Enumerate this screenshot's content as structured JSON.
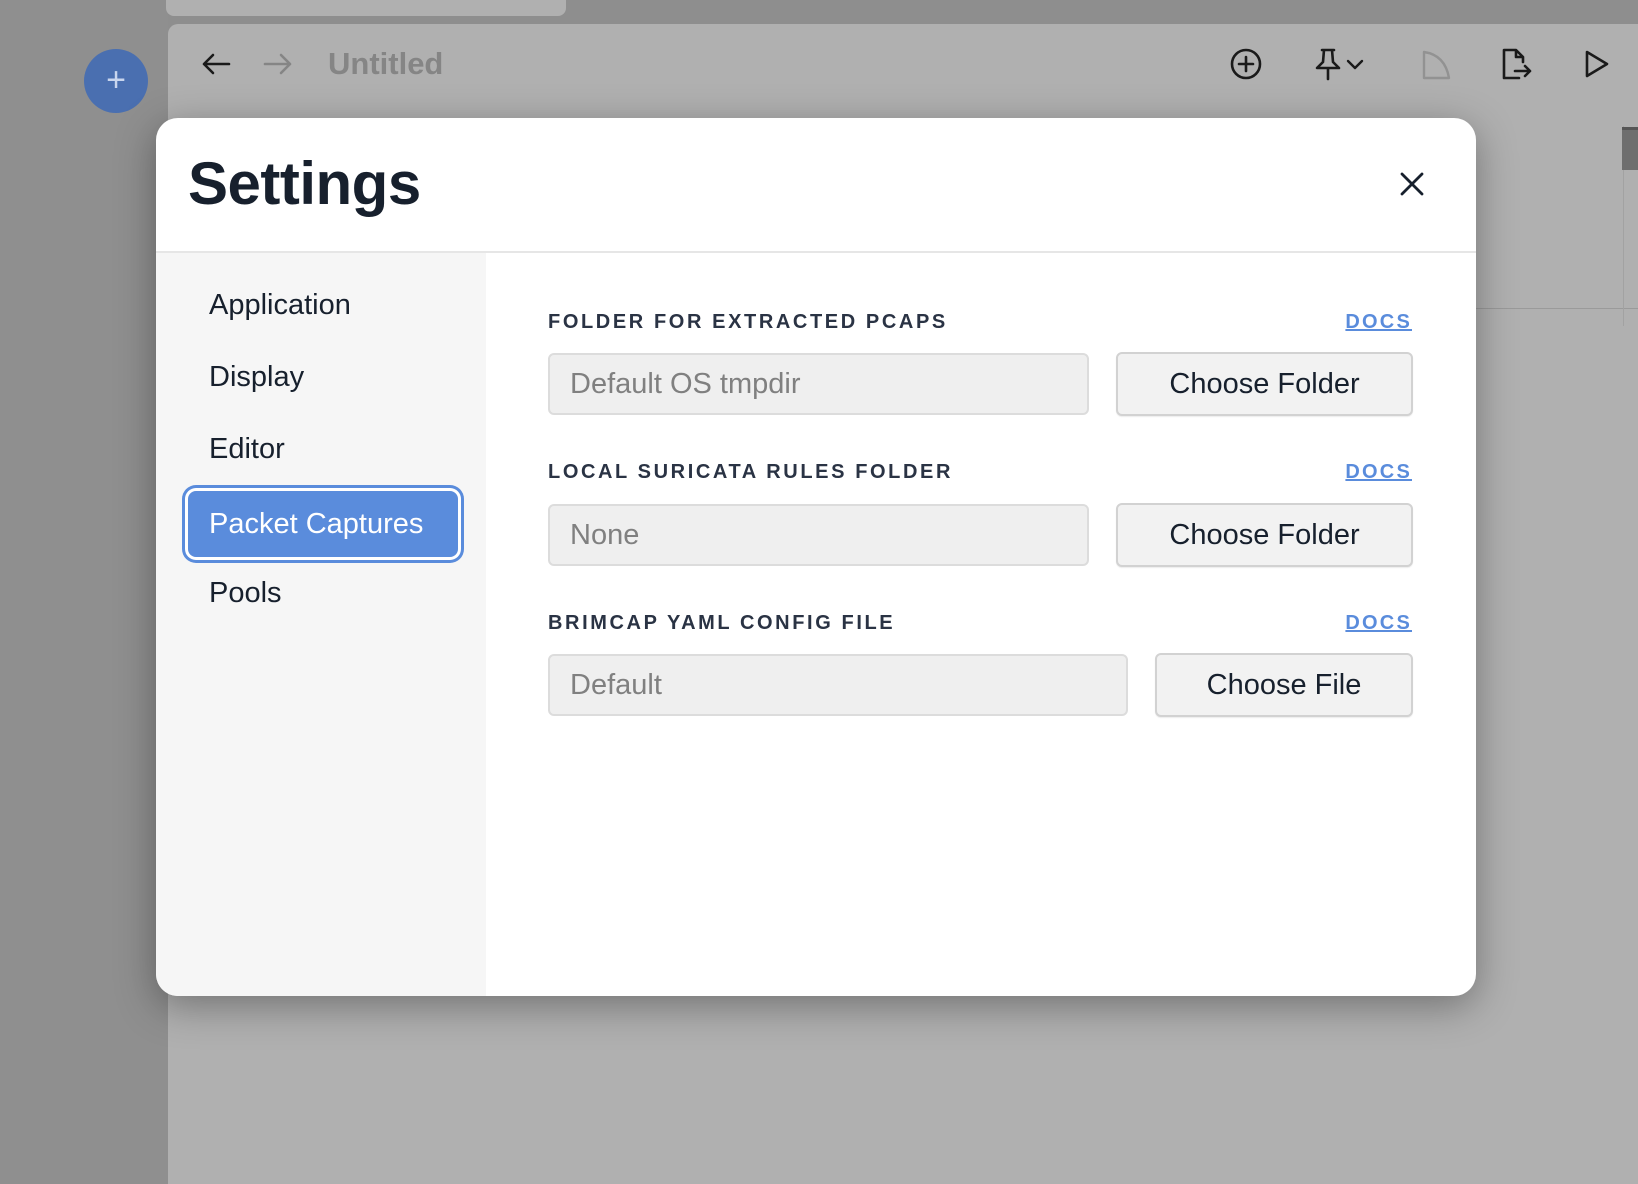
{
  "app": {
    "title": "Untitled",
    "new_button_symbol": "+",
    "toolbar_icons": [
      "arrow-left-icon",
      "arrow-right-icon",
      "plus-circle-icon",
      "pin-icon",
      "chevron-down-icon",
      "shape-icon",
      "export-icon",
      "play-icon"
    ]
  },
  "modal": {
    "title": "Settings",
    "close_icon": "close-icon"
  },
  "sidebar": {
    "items": [
      {
        "label": "Application",
        "active": false
      },
      {
        "label": "Display",
        "active": false
      },
      {
        "label": "Editor",
        "active": false
      },
      {
        "label": "Packet Captures",
        "active": true
      },
      {
        "label": "Pools",
        "active": false
      }
    ]
  },
  "fields": [
    {
      "label": "FOLDER FOR EXTRACTED PCAPS",
      "docs": "DOCS",
      "value": "",
      "placeholder": "Default OS tmpdir",
      "button": "Choose Folder"
    },
    {
      "label": "LOCAL SURICATA RULES FOLDER",
      "docs": "DOCS",
      "value": "",
      "placeholder": "None",
      "button": "Choose Folder"
    },
    {
      "label": "BRIMCAP YAML CONFIG FILE",
      "docs": "DOCS",
      "value": "",
      "placeholder": "Default",
      "button": "Choose File"
    }
  ],
  "colors": {
    "accent": "#5a8cdc",
    "title_text": "#17202d",
    "overlay": "#8e8e8e"
  }
}
